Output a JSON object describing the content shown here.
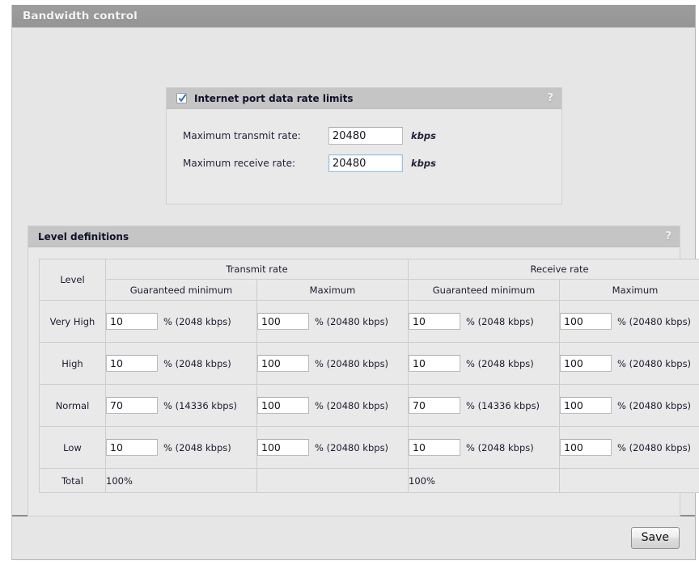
{
  "window": {
    "title": "Bandwidth control"
  },
  "rate_limits_panel": {
    "title": "Internet port data rate limits",
    "checkbox_checked": true,
    "help_label": "?",
    "fields": [
      {
        "label": "Maximum transmit rate:",
        "value": "20480",
        "unit": "kbps",
        "focused": false
      },
      {
        "label": "Maximum receive rate:",
        "value": "20480",
        "unit": "kbps",
        "focused": true
      }
    ]
  },
  "level_definitions_panel": {
    "title": "Level definitions",
    "help_label": "?",
    "table": {
      "level_header": "Level",
      "group_headers": [
        "Transmit rate",
        "Receive rate"
      ],
      "sub_headers": [
        "Guaranteed minimum",
        "Maximum",
        "Guaranteed minimum",
        "Maximum"
      ],
      "rows": [
        {
          "level": "Very High",
          "tx_min": {
            "value": "10",
            "suffix": "% (2048 kbps)"
          },
          "tx_max": {
            "value": "100",
            "suffix": "% (20480 kbps)"
          },
          "rx_min": {
            "value": "10",
            "suffix": "% (2048 kbps)"
          },
          "rx_max": {
            "value": "100",
            "suffix": "% (20480 kbps)"
          }
        },
        {
          "level": "High",
          "tx_min": {
            "value": "10",
            "suffix": "% (2048 kbps)"
          },
          "tx_max": {
            "value": "100",
            "suffix": "% (20480 kbps)"
          },
          "rx_min": {
            "value": "10",
            "suffix": "% (2048 kbps)"
          },
          "rx_max": {
            "value": "100",
            "suffix": "% (20480 kbps)"
          }
        },
        {
          "level": "Normal",
          "tx_min": {
            "value": "70",
            "suffix": "% (14336 kbps)"
          },
          "tx_max": {
            "value": "100",
            "suffix": "% (20480 kbps)"
          },
          "rx_min": {
            "value": "70",
            "suffix": "% (14336 kbps)"
          },
          "rx_max": {
            "value": "100",
            "suffix": "% (20480 kbps)"
          }
        },
        {
          "level": "Low",
          "tx_min": {
            "value": "10",
            "suffix": "% (2048 kbps)"
          },
          "tx_max": {
            "value": "100",
            "suffix": "% (20480 kbps)"
          },
          "rx_min": {
            "value": "10",
            "suffix": "% (2048 kbps)"
          },
          "rx_max": {
            "value": "100",
            "suffix": "% (20480 kbps)"
          }
        }
      ],
      "total_row": {
        "label": "Total",
        "tx_total": "100%",
        "tx_max_total": "",
        "rx_total": "100%",
        "rx_max_total": ""
      }
    }
  },
  "footer": {
    "save_label": "Save"
  },
  "colors": {
    "titlebar": "#9a9a9a",
    "panel_header": "#c5c5c5",
    "page_background": "#e6e6e6",
    "panel_background": "#e9e9e9",
    "checkbox_check": "#2f6fb8",
    "border": "#cdcdcd"
  }
}
